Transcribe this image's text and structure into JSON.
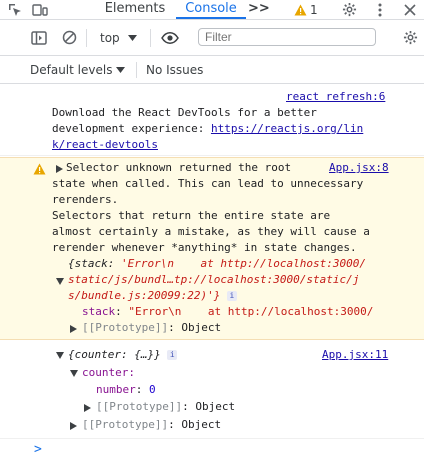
{
  "tabbar": {
    "tabs": [
      {
        "label": "Elements"
      },
      {
        "label": "Console"
      }
    ],
    "more_label": ">>",
    "warning_count": "1"
  },
  "toolbar": {
    "context": "top",
    "filter_placeholder": "Filter"
  },
  "levels": {
    "default_levels": "Default levels",
    "no_issues": "No Issues"
  },
  "console": {
    "msg1": {
      "source": "react refresh:6",
      "line1": "Download the React DevTools for a better",
      "line2_prefix": "development experience: ",
      "line2_link": "https://reactjs.org/lin",
      "line3_link": "k/react-devtools"
    },
    "warn": {
      "source": "App.jsx:8",
      "lines": [
        "Selector unknown returned the root",
        "state when called. This can lead to unnecessary",
        "rerenders.",
        "Selectors that return the entire state are",
        "almost certainly a mistake, as they will cause a",
        "rerender whenever *anything* in state changes."
      ],
      "stack_line1_key": "{stack: ",
      "stack_line1_val": "'Error\\n    at http://localhost:3000/",
      "stack_line2": "static/js/bundl…tp://localhost:3000/static/j",
      "stack_line3": "s/bundle.js:20099:22)'}",
      "stack_key": "stack",
      "stack_val": "\"Error\\n    at http://localhost:3000/",
      "proto": "[[Prototype]]",
      "proto_val": "Object"
    },
    "obj": {
      "source": "App.jsx:11",
      "summary": "{counter: {…}}",
      "counter_key": "counter",
      "number_key": "number",
      "number_val": "0",
      "proto": "[[Prototype]]",
      "proto_val": "Object"
    },
    "prompt": ">"
  }
}
